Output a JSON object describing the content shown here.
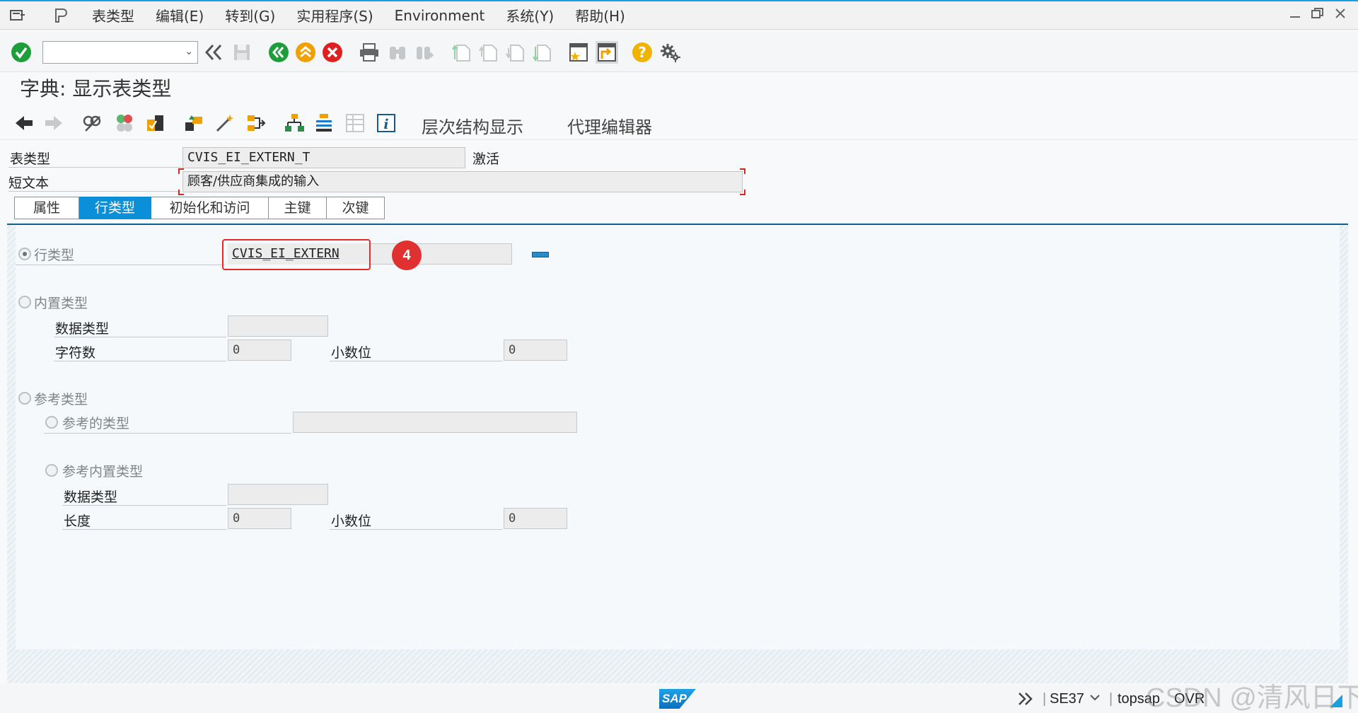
{
  "menu": {
    "items": [
      "表类型",
      "编辑(E)",
      "转到(G)",
      "实用程序(S)",
      "Environment",
      "系统(Y)",
      "帮助(H)"
    ]
  },
  "toolbar": {
    "command_value": "",
    "icons": [
      "enter-icon",
      "back-double-icon",
      "save-icon",
      "back-icon",
      "exit-icon",
      "cancel-icon",
      "print-icon",
      "find-icon",
      "find-next-icon",
      "first-page-icon",
      "prev-page-icon",
      "next-page-icon",
      "last-page-icon",
      "new-session-icon",
      "shortcut-icon",
      "help-icon",
      "settings-icon"
    ]
  },
  "page": {
    "title": "字典: 显示表类型"
  },
  "app_toolbar": {
    "hierarchy_label": "层次结构显示",
    "proxy_label": "代理编辑器"
  },
  "header": {
    "table_type_label": "表类型",
    "table_type_value": "CVIS_EI_EXTERN_T",
    "status": "激活",
    "short_text_label": "短文本",
    "short_text_value": "顾客/供应商集成的输入"
  },
  "tabs": [
    {
      "label": "属性",
      "active": false
    },
    {
      "label": "行类型",
      "active": true
    },
    {
      "label": "初始化和访问",
      "active": false
    },
    {
      "label": "主键",
      "active": false
    },
    {
      "label": "次键",
      "active": false
    }
  ],
  "row_type": {
    "label": "行类型",
    "value": "CVIS_EI_EXTERN",
    "badge": "4"
  },
  "builtin": {
    "label": "内置类型",
    "data_type_label": "数据类型",
    "data_type_value": "",
    "chars_label": "字符数",
    "chars_value": "0",
    "decimals_label": "小数位",
    "decimals_value": "0"
  },
  "reference": {
    "label": "参考类型",
    "ref_type_label": "参考的类型",
    "ref_type_value": "",
    "ref_builtin_label": "参考内置类型",
    "data_type_label": "数据类型",
    "data_type_value": "",
    "length_label": "长度",
    "length_value": "0",
    "decimals_label": "小数位",
    "decimals_value": "0"
  },
  "status_bar": {
    "transaction": "SE37",
    "server": "topsap",
    "mode": "OVR",
    "logo": "SAP",
    "watermark": "CSDN @清风日下"
  },
  "colors": {
    "accent": "#0a8fd8",
    "highlight": "#e02b2b",
    "enter_green": "#1e9e3a",
    "exit_orange": "#f0a000",
    "cancel_red": "#e02020"
  }
}
